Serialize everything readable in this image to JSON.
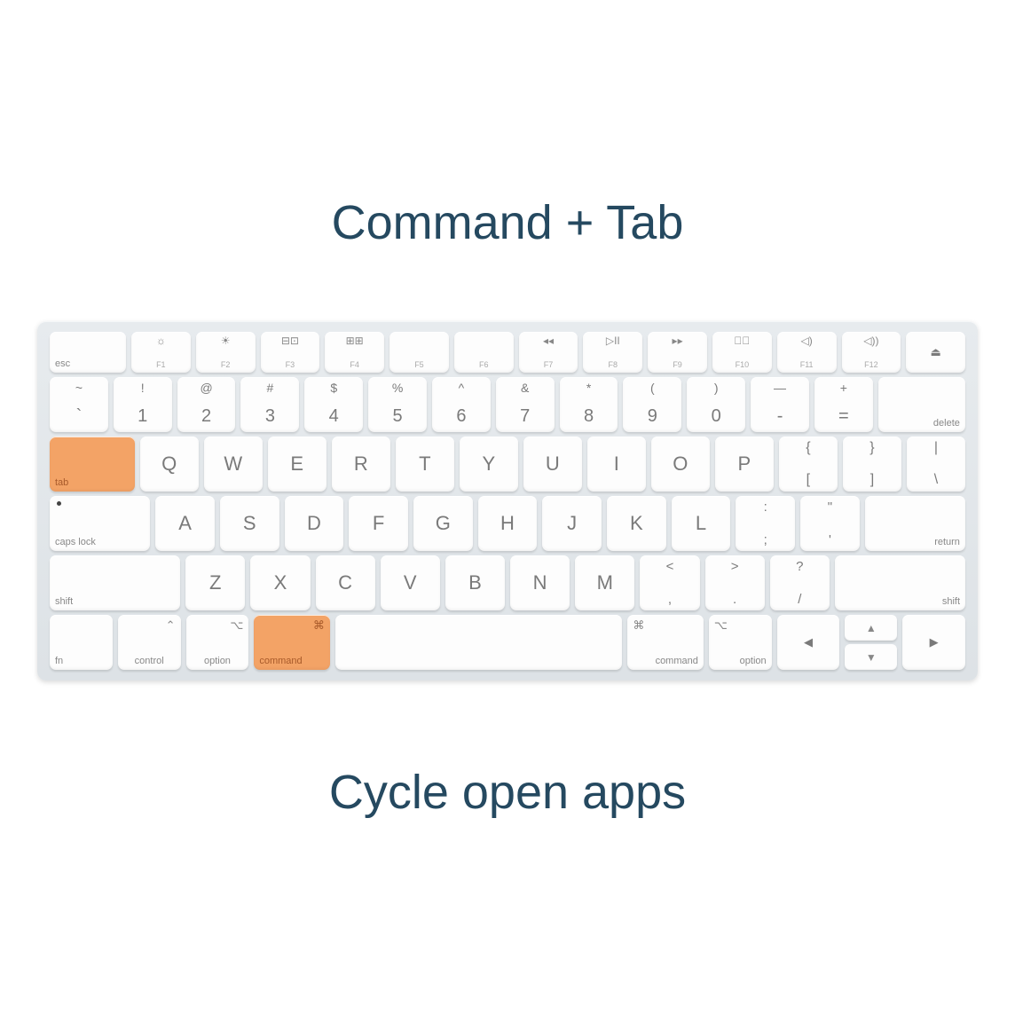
{
  "title": "Command + Tab",
  "subtitle": "Cycle open apps",
  "highlight_color": "#f3a366",
  "rows": {
    "fn": {
      "esc": "esc",
      "keys": [
        {
          "icon": "☼",
          "label": "F1"
        },
        {
          "icon": "☀",
          "label": "F2"
        },
        {
          "icon": "⊟⊡",
          "label": "F3"
        },
        {
          "icon": "⊞⊞",
          "label": "F4"
        },
        {
          "icon": "",
          "label": "F5"
        },
        {
          "icon": "",
          "label": "F6"
        },
        {
          "icon": "◂◂",
          "label": "F7"
        },
        {
          "icon": "▷II",
          "label": "F8"
        },
        {
          "icon": "▸▸",
          "label": "F9"
        },
        {
          "icon": "◁⃠",
          "label": "F10"
        },
        {
          "icon": "◁)",
          "label": "F11"
        },
        {
          "icon": "◁))",
          "label": "F12"
        }
      ],
      "eject": "⏏"
    },
    "num": {
      "keys": [
        {
          "top": "~",
          "bottom": "`"
        },
        {
          "top": "!",
          "bottom": "1"
        },
        {
          "top": "@",
          "bottom": "2"
        },
        {
          "top": "#",
          "bottom": "3"
        },
        {
          "top": "$",
          "bottom": "4"
        },
        {
          "top": "%",
          "bottom": "5"
        },
        {
          "top": "^",
          "bottom": "6"
        },
        {
          "top": "&",
          "bottom": "7"
        },
        {
          "top": "*",
          "bottom": "8"
        },
        {
          "top": "(",
          "bottom": "9"
        },
        {
          "top": ")",
          "bottom": "0"
        },
        {
          "top": "—",
          "bottom": "-"
        },
        {
          "top": "+",
          "bottom": "="
        }
      ],
      "delete": "delete"
    },
    "qwerty": {
      "tab": "tab",
      "letters": [
        "Q",
        "W",
        "E",
        "R",
        "T",
        "Y",
        "U",
        "I",
        "O",
        "P"
      ],
      "brackets": [
        {
          "top": "{",
          "bottom": "["
        },
        {
          "top": "}",
          "bottom": "]"
        },
        {
          "top": "|",
          "bottom": "\\"
        }
      ]
    },
    "asdf": {
      "caps": "caps lock",
      "letters": [
        "A",
        "S",
        "D",
        "F",
        "G",
        "H",
        "J",
        "K",
        "L"
      ],
      "punct": [
        {
          "top": ":",
          "bottom": ";"
        },
        {
          "top": "\"",
          "bottom": "'"
        }
      ],
      "return": "return"
    },
    "zxcv": {
      "shift": "shift",
      "letters": [
        "Z",
        "X",
        "C",
        "V",
        "B",
        "N",
        "M"
      ],
      "punct": [
        {
          "top": "<",
          "bottom": ","
        },
        {
          "top": ">",
          "bottom": "."
        },
        {
          "top": "?",
          "bottom": "/"
        }
      ]
    },
    "bottom": {
      "fn": "fn",
      "control": {
        "icon": "⌃",
        "label": "control"
      },
      "option_l": {
        "icon": "⌥",
        "label": "option"
      },
      "command_l": {
        "icon": "⌘",
        "label": "command"
      },
      "command_r": {
        "icon": "⌘",
        "label": "command"
      },
      "option_r": {
        "icon": "⌥",
        "label": "option"
      },
      "arrows": {
        "left": "◀",
        "up": "▲",
        "down": "▼",
        "right": "▶"
      }
    }
  }
}
